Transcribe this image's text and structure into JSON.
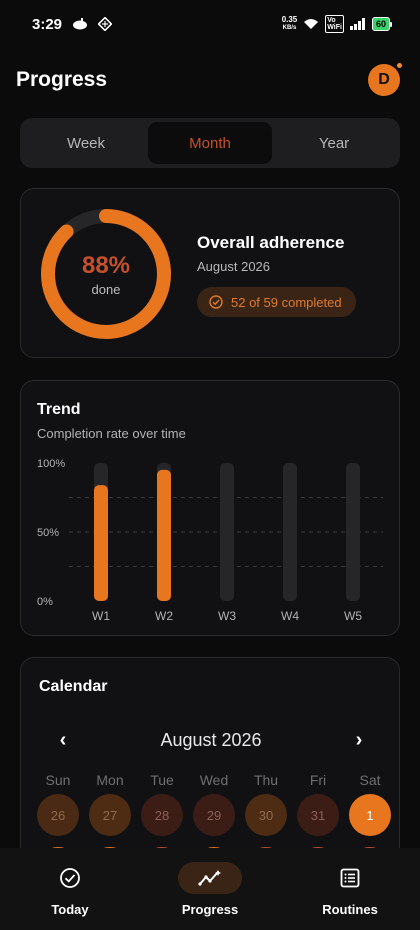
{
  "status_bar": {
    "time": "3:29",
    "net_speed_value": "0.35",
    "net_speed_unit": "KB/s",
    "volte_top": "Vo",
    "volte_bottom": "WiFi",
    "battery": "60"
  },
  "header": {
    "title": "Progress",
    "avatar_letter": "D"
  },
  "period_tabs": [
    {
      "label": "Week",
      "active": false
    },
    {
      "label": "Month",
      "active": true
    },
    {
      "label": "Year",
      "active": false
    }
  ],
  "adherence": {
    "percent_text": "88%",
    "percent_value": 88,
    "sub": "done",
    "title": "Overall adherence",
    "date": "August 2026",
    "badge": "52 of 59 completed"
  },
  "trend": {
    "title": "Trend",
    "subtitle": "Completion rate over time",
    "chart_data": {
      "type": "bar",
      "categories": [
        "W1",
        "W2",
        "W3",
        "W4",
        "W5"
      ],
      "values": [
        84,
        95,
        0,
        0,
        0
      ],
      "ylim": [
        0,
        100
      ],
      "yticks": [
        "100%",
        "50%",
        "0%"
      ],
      "colors": {
        "bar": "#e8761f",
        "track": "#262628"
      }
    }
  },
  "calendar": {
    "title": "Calendar",
    "month": "August 2026",
    "prev_arrow": "‹",
    "next_arrow": "›",
    "weekdays": [
      "Sun",
      "Mon",
      "Tue",
      "Wed",
      "Thu",
      "Fri",
      "Sat"
    ],
    "days": [
      {
        "label": "26",
        "color": "#4a2a14",
        "text_color": "#8f6a4e"
      },
      {
        "label": "27",
        "color": "#4d2c13",
        "text_color": "#8f6a4e"
      },
      {
        "label": "28",
        "color": "#3c1d16",
        "text_color": "#8a5f55"
      },
      {
        "label": "29",
        "color": "#3c1d16",
        "text_color": "#8a5f55"
      },
      {
        "label": "30",
        "color": "#4d2c13",
        "text_color": "#8f6a4e"
      },
      {
        "label": "31",
        "color": "#3c1d16",
        "text_color": "#8a5f55"
      },
      {
        "label": "1",
        "color": "#e8761f",
        "text_color": "#ffffff"
      }
    ],
    "next_row_colors": [
      "#e8761f",
      "#e8761f",
      "#c4502c",
      "#e8761f",
      "#c4502c",
      "#c4502c",
      "#c4502c"
    ]
  },
  "bottom_nav": [
    {
      "label": "Today",
      "icon": "check-circle-icon",
      "active": false
    },
    {
      "label": "Progress",
      "icon": "trend-icon",
      "active": true
    },
    {
      "label": "Routines",
      "icon": "list-icon",
      "active": false
    }
  ]
}
